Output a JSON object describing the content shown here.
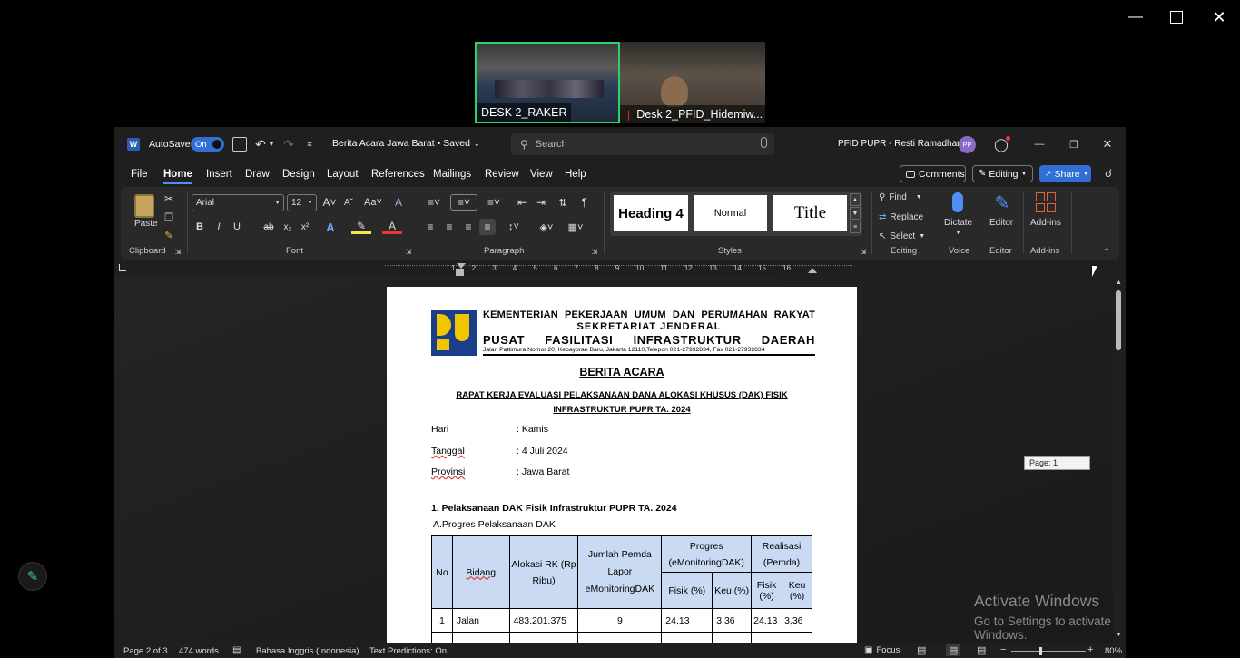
{
  "meeting": {
    "tiles": [
      {
        "label": "DESK 2_RAKER"
      },
      {
        "label": "Desk 2_PFID_Hidemiw..."
      }
    ]
  },
  "word": {
    "autosave_label": "AutoSave",
    "autosave_state": "On",
    "doc_title": "Berita Acara Jawa Barat • Saved",
    "search_placeholder": "Search",
    "user_name": "PFID PUPR - Resti Ramadhanti",
    "user_initials": "PP",
    "menu": [
      "File",
      "Home",
      "Insert",
      "Draw",
      "Design",
      "Layout",
      "References",
      "Mailings",
      "Review",
      "View",
      "Help"
    ],
    "comments_label": "Comments",
    "editing_label": "Editing",
    "share_label": "Share",
    "ribbon": {
      "paste_label": "Paste",
      "clipboard_label": "Clipboard",
      "font_name": "Arial",
      "font_size": "12",
      "font_label": "Font",
      "paragraph_label": "Paragraph",
      "styles_label": "Styles",
      "style_heading4": "Heading 4",
      "style_normal": "Normal",
      "style_title": "Title",
      "find_label": "Find",
      "replace_label": "Replace",
      "select_label": "Select",
      "editing_group_label": "Editing",
      "dictate_label": "Dictate",
      "voice_label": "Voice",
      "editor_label": "Editor",
      "editor_group_label": "Editor",
      "addins_label": "Add-ins",
      "addins_group_label": "Add-ins"
    },
    "ruler_numbers": [
      "1",
      "2",
      "3",
      "4",
      "5",
      "6",
      "7",
      "8",
      "9",
      "10",
      "11",
      "12",
      "13",
      "14",
      "15",
      "16"
    ],
    "page_tooltip": "Page: 1",
    "status": {
      "page": "Page 2 of 3",
      "words": "474 words",
      "language": "Bahasa Inggris (Indonesia)",
      "predictions": "Text Predictions: On",
      "focus": "Focus",
      "zoom": "80%"
    }
  },
  "document": {
    "kop_line1": "KEMENTERIAN PEKERJAAN UMUM DAN PERUMAHAN RAKYAT",
    "kop_line2": "SEKRETARIAT JENDERAL",
    "kop_line3": "PUSAT FASILITASI INFRASTRUKTUR DAERAH",
    "kop_address": "Jalan Pattimura Nomor 20, Kebayoran Baru, Jakarta 12110,Telepon 021-27932834, Fax 021-27932834",
    "heading": "BERITA ACARA",
    "subheading1": "RAPAT KERJA EVALUASI PELAKSANAAN DANA ALOKASI KHUSUS (DAK) FISIK",
    "subheading2": "INFRASTRUKTUR PUPR TA. 2024",
    "fields": [
      {
        "label": "Hari",
        "value": ": Kamis"
      },
      {
        "label": "Tanggal",
        "value": ": 4 Juli 2024"
      },
      {
        "label": "Provinsi",
        "value": ": Jawa Barat"
      }
    ],
    "section1": "1. Pelaksanaan DAK Fisik Infrastruktur PUPR TA. 2024",
    "section1a": "A.Progres Pelaksanaan DAK",
    "table": {
      "h_no": "No",
      "h_bidang": "Bidang",
      "h_alokasi": "Alokasi RK (Rp Ribu)",
      "h_jumlah": "Jumlah Pemda Lapor eMonitoringDAK",
      "h_progres": "Progres (eMonitoringDAK)",
      "h_realisasi": "Realisasi (Pemda)",
      "h_fisik1": "Fisik (%)",
      "h_keu1": "Keu (%)",
      "h_fisik2": "Fisik (%)",
      "h_keu2": "Keu (%)",
      "row1": [
        "1",
        "Jalan",
        "483.201.375",
        "9",
        "24,13",
        "3,36",
        "24,13",
        "3,36"
      ]
    }
  },
  "watermark": {
    "line1": "Activate Windows",
    "line2": "Go to Settings to activate Windows."
  }
}
